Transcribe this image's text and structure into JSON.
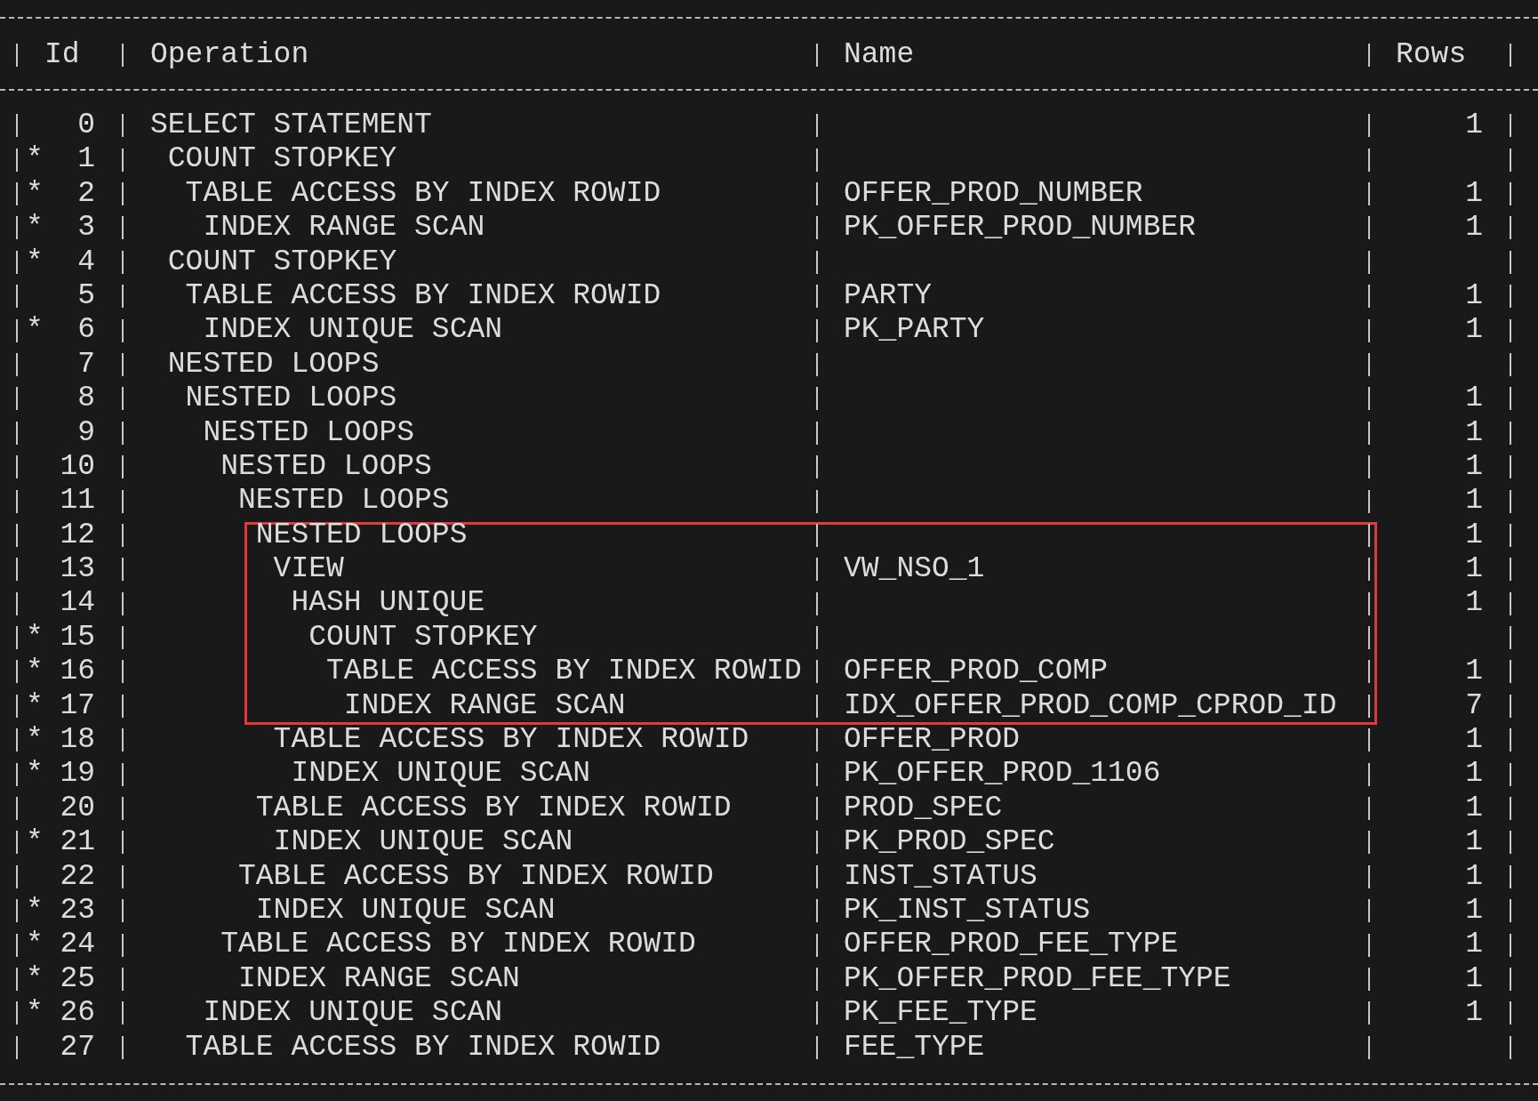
{
  "columns": [
    "Id",
    "Operation",
    "Name",
    "Rows"
  ],
  "plan": [
    {
      "id": "0",
      "operation": "SELECT STATEMENT",
      "rows": "1",
      "boxed": false,
      "children": [
        {
          "id": "1",
          "predicate": "*",
          "operation": "COUNT STOPKEY",
          "boxed": false,
          "children": [
            {
              "id": "2",
              "predicate": "*",
              "operation": "TABLE ACCESS BY INDEX ROWID",
              "name": "OFFER_PROD_NUMBER",
              "rows": "1",
              "boxed": false,
              "children": [
                {
                  "id": "3",
                  "predicate": "*",
                  "operation": "INDEX RANGE SCAN",
                  "name": "PK_OFFER_PROD_NUMBER",
                  "rows": "1",
                  "boxed": false
                }
              ]
            }
          ]
        },
        {
          "id": "4",
          "predicate": "*",
          "operation": "COUNT STOPKEY",
          "boxed": false,
          "children": [
            {
              "id": "5",
              "operation": "TABLE ACCESS BY INDEX ROWID",
              "name": "PARTY",
              "rows": "1",
              "boxed": false,
              "children": [
                {
                  "id": "6",
                  "predicate": "*",
                  "operation": "INDEX UNIQUE SCAN",
                  "name": "PK_PARTY",
                  "rows": "1",
                  "boxed": false
                }
              ]
            }
          ]
        },
        {
          "id": "7",
          "operation": "NESTED LOOPS",
          "boxed": false,
          "children": [
            {
              "id": "8",
              "operation": "NESTED LOOPS",
              "rows": "1",
              "boxed": false,
              "children": [
                {
                  "id": "9",
                  "operation": "NESTED LOOPS",
                  "rows": "1",
                  "boxed": false,
                  "children": [
                    {
                      "id": "10",
                      "operation": "NESTED LOOPS",
                      "rows": "1",
                      "boxed": false,
                      "children": [
                        {
                          "id": "11",
                          "operation": "NESTED LOOPS",
                          "rows": "1",
                          "boxed": false,
                          "children": [
                            {
                              "id": "12",
                              "operation": "NESTED LOOPS",
                              "rows": "1",
                              "boxed": true,
                              "children": [
                                {
                                  "id": "13",
                                  "operation": "VIEW",
                                  "name": "VW_NSO_1",
                                  "rows": "1",
                                  "boxed": true,
                                  "children": [
                                    {
                                      "id": "14",
                                      "operation": "HASH UNIQUE",
                                      "rows": "1",
                                      "boxed": true,
                                      "children": [
                                        {
                                          "id": "15",
                                          "predicate": "*",
                                          "operation": "COUNT STOPKEY",
                                          "boxed": true,
                                          "children": [
                                            {
                                              "id": "16",
                                              "predicate": "*",
                                              "operation": "TABLE ACCESS BY INDEX ROWID",
                                              "name": "OFFER_PROD_COMP",
                                              "rows": "1",
                                              "boxed": true,
                                              "children": [
                                                {
                                                  "id": "17",
                                                  "predicate": "*",
                                                  "operation": "INDEX RANGE SCAN",
                                                  "name": "IDX_OFFER_PROD_COMP_CPROD_ID",
                                                  "rows": "7",
                                                  "boxed": true
                                                }
                                              ]
                                            }
                                          ]
                                        }
                                      ]
                                    }
                                  ]
                                },
                                {
                                  "id": "18",
                                  "predicate": "*",
                                  "operation": "TABLE ACCESS BY INDEX ROWID",
                                  "name": "OFFER_PROD",
                                  "rows": "1",
                                  "boxed": false,
                                  "children": [
                                    {
                                      "id": "19",
                                      "predicate": "*",
                                      "operation": "INDEX UNIQUE SCAN",
                                      "name": "PK_OFFER_PROD_1106",
                                      "rows": "1",
                                      "boxed": false
                                    }
                                  ]
                                }
                              ]
                            },
                            {
                              "id": "20",
                              "operation": "TABLE ACCESS BY INDEX ROWID",
                              "name": "PROD_SPEC",
                              "rows": "1",
                              "boxed": false,
                              "children": [
                                {
                                  "id": "21",
                                  "predicate": "*",
                                  "operation": "INDEX UNIQUE SCAN",
                                  "name": "PK_PROD_SPEC",
                                  "rows": "1",
                                  "boxed": false
                                }
                              ]
                            }
                          ]
                        },
                        {
                          "id": "22",
                          "operation": "TABLE ACCESS BY INDEX ROWID",
                          "name": "INST_STATUS",
                          "rows": "1",
                          "boxed": false,
                          "children": [
                            {
                              "id": "23",
                              "predicate": "*",
                              "operation": "INDEX UNIQUE SCAN",
                              "name": "PK_INST_STATUS",
                              "rows": "1",
                              "boxed": false
                            }
                          ]
                        }
                      ]
                    },
                    {
                      "id": "24",
                      "predicate": "*",
                      "operation": "TABLE ACCESS BY INDEX ROWID",
                      "name": "OFFER_PROD_FEE_TYPE",
                      "rows": "1",
                      "boxed": false,
                      "children": [
                        {
                          "id": "25",
                          "predicate": "*",
                          "operation": "INDEX RANGE SCAN",
                          "name": "PK_OFFER_PROD_FEE_TYPE",
                          "rows": "1",
                          "boxed": false
                        }
                      ]
                    }
                  ]
                },
                {
                  "id": "26",
                  "predicate": "*",
                  "operation": "INDEX UNIQUE SCAN",
                  "name": "PK_FEE_TYPE",
                  "rows": "1",
                  "boxed": false
                }
              ]
            },
            {
              "id": "27",
              "operation": "TABLE ACCESS BY INDEX ROWID",
              "name": "FEE_TYPE",
              "boxed": false
            }
          ]
        }
      ]
    }
  ]
}
